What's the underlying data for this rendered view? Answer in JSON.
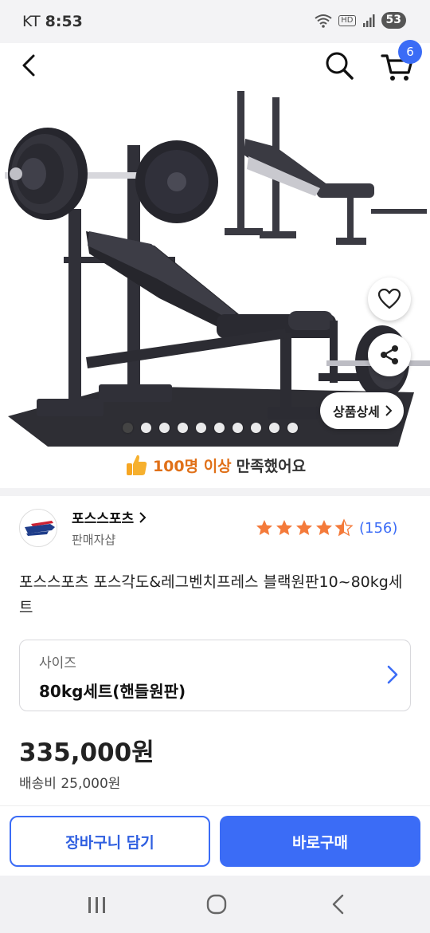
{
  "status_bar": {
    "carrier": "KT",
    "time": "8:53",
    "hd_label": "HD",
    "battery": "53"
  },
  "header": {
    "back_icon": "back-arrow-icon",
    "search_icon": "search-icon",
    "cart_icon": "cart-icon",
    "cart_count": "6"
  },
  "hero": {
    "detail_button_label": "상품상세",
    "image_count": 10,
    "active_index": 0
  },
  "satisfaction": {
    "highlight": "100명 이상",
    "text": "만족했어요"
  },
  "seller": {
    "name": "포스스포츠",
    "type": "판매자샵",
    "rating": 4.5,
    "review_count": "(156)"
  },
  "product": {
    "title": "포스스포츠 포스각도&레그벤치프레스 블랙원판10~80kg세트"
  },
  "option": {
    "label": "사이즈",
    "value": "80kg세트(핸들원판)"
  },
  "price": {
    "amount": "335,000원",
    "shipping": "배송비 25,000원"
  },
  "bottom_bar": {
    "add_to_cart": "장바구니 담기",
    "buy_now": "바로구매"
  },
  "colors": {
    "accent": "#3b6cf6",
    "star": "#f47a3a",
    "highlight": "#e07018"
  }
}
